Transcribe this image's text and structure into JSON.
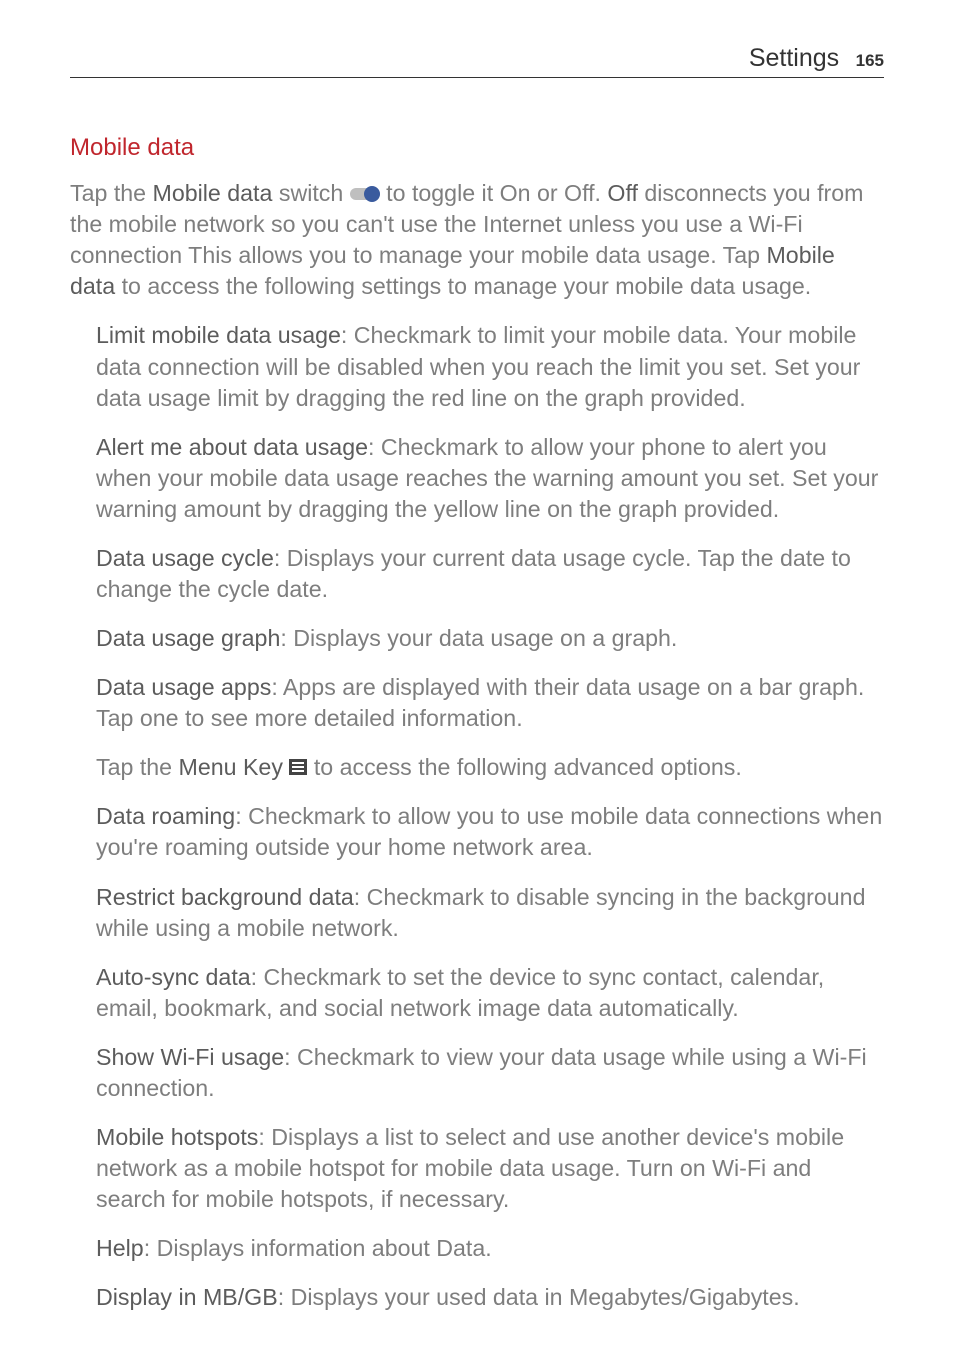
{
  "header": {
    "title": "Settings",
    "page": "165"
  },
  "section": {
    "heading": "Mobile data",
    "intro_1a": "Tap the ",
    "intro_1b": "Mobile data",
    "intro_1c": " switch ",
    "intro_1d": " to toggle it On or Off. ",
    "intro_1e": "Off",
    "intro_1f": " disconnects you from the mobile network so you can't use the Internet unless you use a Wi-Fi connection This allows you to manage your mobile data usage. Tap ",
    "intro_1g": "Mobile data",
    "intro_1h": " to access the following settings to manage your mobile data usage."
  },
  "items": [
    {
      "term": "Limit mobile data usage",
      "desc": ": Checkmark to limit your mobile data. Your mobile data connection will be disabled when you reach the limit you set. Set your data usage limit by dragging the red line on the graph provided."
    },
    {
      "term": "Alert me about data usage",
      "desc": ": Checkmark to allow your phone to alert you when your mobile data usage reaches the warning amount you set. Set your warning amount by dragging the yellow line on the graph provided."
    },
    {
      "term": "Data usage cycle",
      "desc": ": Displays your current data usage cycle. Tap the date to change the cycle date."
    },
    {
      "term": "Data usage graph",
      "desc": ": Displays your data usage on a graph."
    },
    {
      "term": "Data usage apps",
      "desc": ": Apps are displayed with their data usage on a bar graph. Tap one to see more detailed information."
    }
  ],
  "menu_line_a": "Tap the ",
  "menu_line_b": "Menu Key",
  "menu_line_c": " to access the following advanced options.",
  "adv": [
    {
      "term": "Data roaming",
      "desc": ": Checkmark to allow you to use mobile data connections when you're roaming outside your home network area."
    },
    {
      "term": "Restrict background data",
      "desc": ": Checkmark to disable syncing in the background while using a mobile network."
    },
    {
      "term": "Auto-sync data",
      "desc": ": Checkmark to set the device to sync contact, calendar, email, bookmark, and social network image data automatically."
    },
    {
      "term": "Show Wi-Fi usage",
      "desc": ": Checkmark to view your data usage while using a Wi-Fi connection."
    },
    {
      "term": "Mobile hotspots",
      "desc": ": Displays a list to select and use another device's mobile network as a mobile hotspot for mobile data usage. Turn on Wi-Fi and search for mobile hotspots, if necessary."
    },
    {
      "term": "Help",
      "desc": ": Displays information about Data."
    },
    {
      "term": "Display in MB/GB",
      "desc": ": Displays your used data in Megabytes/Gigabytes."
    }
  ]
}
